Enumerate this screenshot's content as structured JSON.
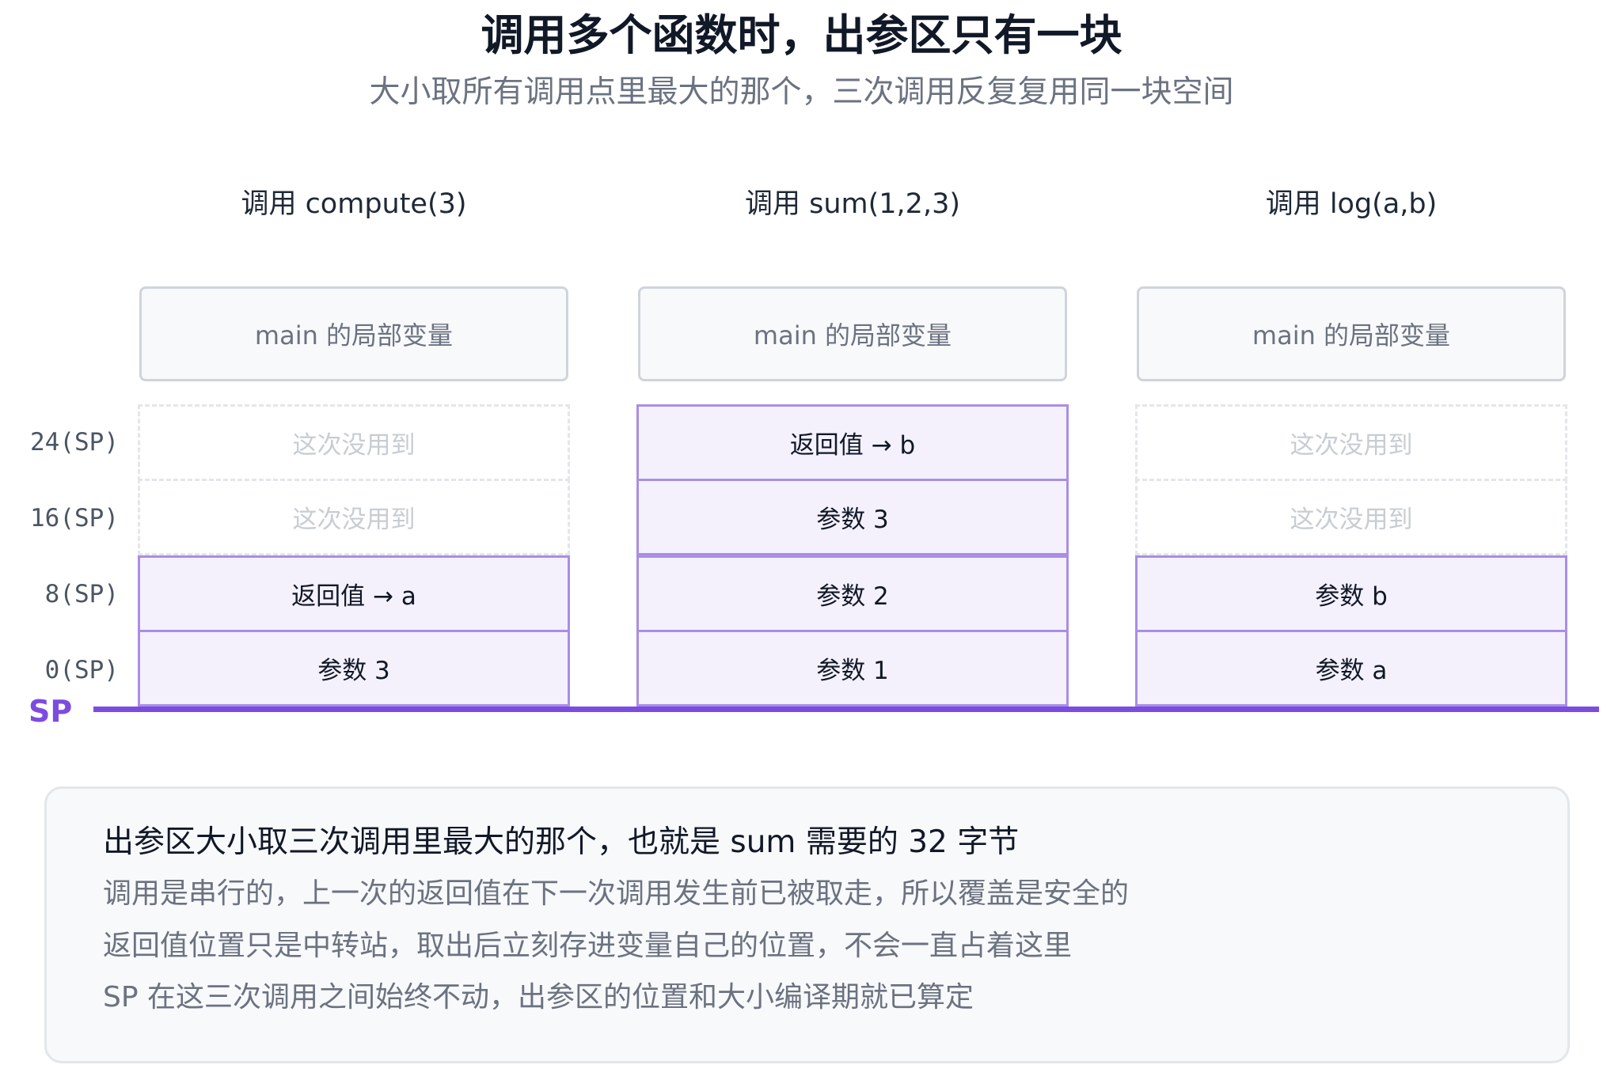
{
  "title": "调用多个函数时，出参区只有一块",
  "subtitle": "大小取所有调用点里最大的那个，三次调用反复复用同一块空间",
  "offsets": [
    "24(SP)",
    "16(SP)",
    "8(SP)",
    "0(SP)"
  ],
  "sp_label": "SP",
  "columns": [
    {
      "label": "调用 compute(3)",
      "main": "main 的局部变量",
      "slots": [
        {
          "text": "这次没用到",
          "used": false
        },
        {
          "text": "这次没用到",
          "used": false
        },
        {
          "text": "返回值 → a",
          "used": true
        },
        {
          "text": "参数 3",
          "used": true
        }
      ]
    },
    {
      "label": "调用 sum(1,2,3)",
      "main": "main 的局部变量",
      "slots": [
        {
          "text": "返回值 → b",
          "used": true
        },
        {
          "text": "参数 3",
          "used": true
        },
        {
          "text": "参数 2",
          "used": true
        },
        {
          "text": "参数 1",
          "used": true
        }
      ]
    },
    {
      "label": "调用 log(a,b)",
      "main": "main 的局部变量",
      "slots": [
        {
          "text": "这次没用到",
          "used": false
        },
        {
          "text": "这次没用到",
          "used": false
        },
        {
          "text": "参数 b",
          "used": true
        },
        {
          "text": "参数 a",
          "used": true
        }
      ]
    }
  ],
  "note": {
    "heading": "出参区大小取三次调用里最大的那个，也就是 sum 需要的 32 字节",
    "lines": [
      "调用是串行的，上一次的返回值在下一次调用发生前已被取走，所以覆盖是安全的",
      "返回值位置只是中转站，取出后立刻存进变量自己的位置，不会一直占着这里",
      "SP 在这三次调用之间始终不动，出参区的位置和大小编译期就已算定"
    ]
  },
  "colors": {
    "accent": "#7c4ce0",
    "used_border": "#a98ee6",
    "used_fill": "#f4f1fd",
    "unused_border": "#e3e6ea",
    "unused_text": "#c8ccd3"
  }
}
